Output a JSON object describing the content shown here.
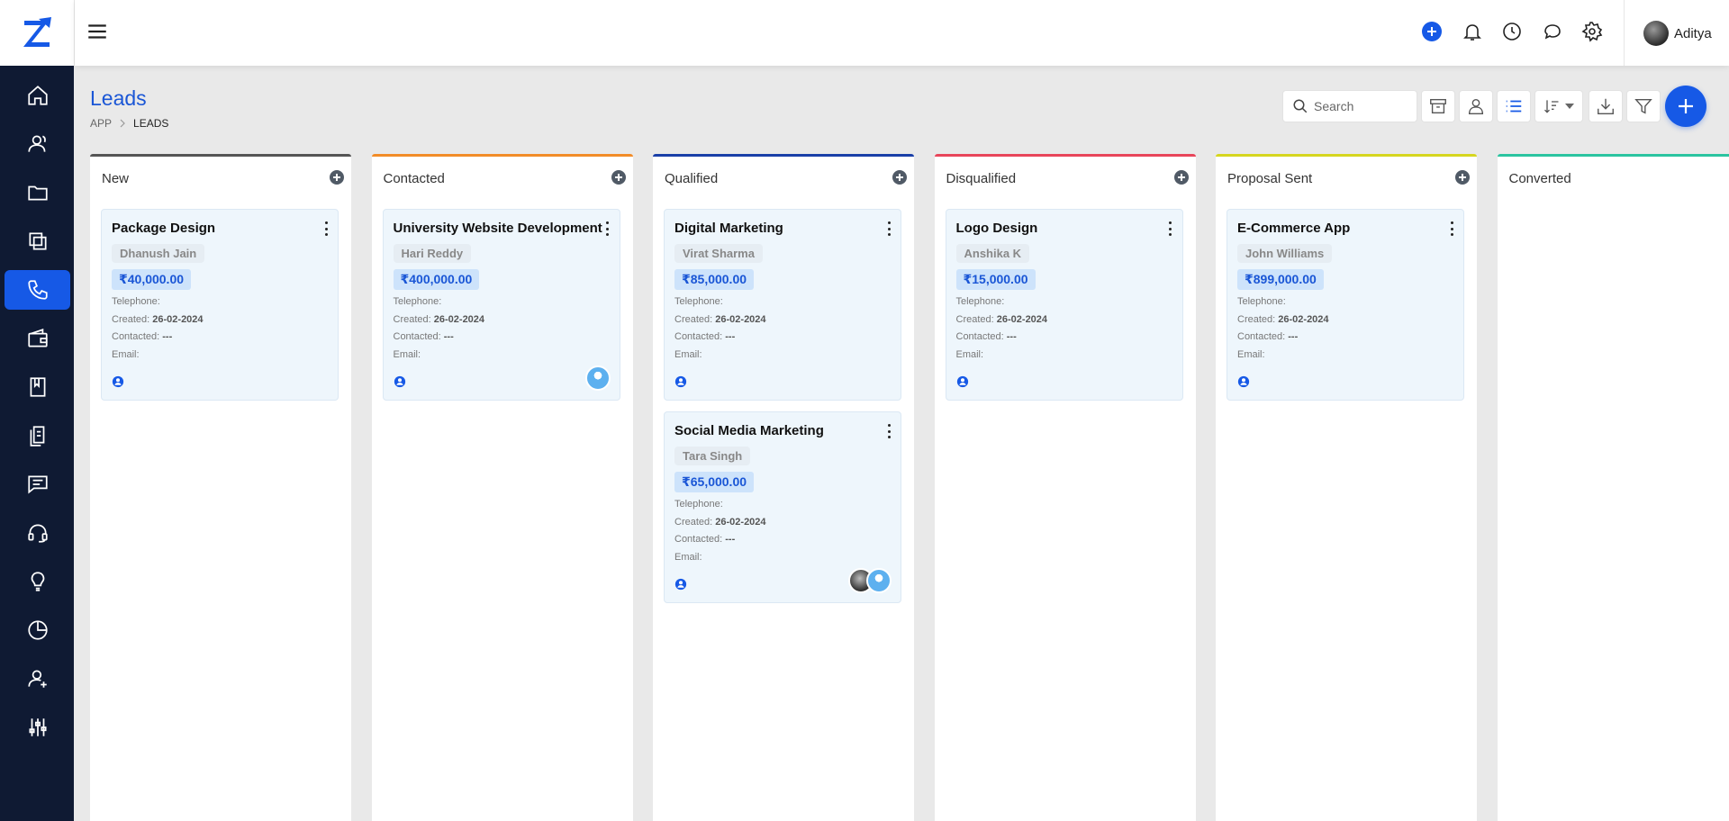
{
  "user": {
    "name": "Aditya"
  },
  "page": {
    "title": "Leads"
  },
  "breadcrumb": {
    "root": "APP",
    "current": "LEADS"
  },
  "toolbar": {
    "search_placeholder": "Search"
  },
  "colors": {
    "accent": "#1659e6",
    "sidebar": "#0f1a33"
  },
  "sidebar_icons": [
    "home-icon",
    "contacts-icon",
    "folder-icon",
    "copy-icon",
    "phone-icon",
    "wallet-icon",
    "book-icon",
    "documents-icon",
    "chat-icon",
    "headset-icon",
    "lightbulb-icon",
    "pie-chart-icon",
    "user-add-icon",
    "sliders-icon"
  ],
  "columns": [
    {
      "name": "New",
      "color": "#555555",
      "cards": [
        {
          "title": "Package Design",
          "contact": "Dhanush Jain",
          "amount": "₹40,000.00",
          "telephone": "",
          "created": "26-02-2024",
          "contacted": "---",
          "email": "",
          "avatars": []
        }
      ]
    },
    {
      "name": "Contacted",
      "color": "#f28c28",
      "cards": [
        {
          "title": "University Website Development",
          "contact": "Hari Reddy",
          "amount": "₹400,000.00",
          "telephone": "",
          "created": "26-02-2024",
          "contacted": "---",
          "email": "",
          "avatars": [
            "blue"
          ]
        }
      ]
    },
    {
      "name": "Qualified",
      "color": "#1a3fa8",
      "cards": [
        {
          "title": "Digital Marketing",
          "contact": "Virat Sharma",
          "amount": "₹85,000.00",
          "telephone": "",
          "created": "26-02-2024",
          "contacted": "---",
          "email": "",
          "avatars": []
        },
        {
          "title": "Social Media Marketing",
          "contact": "Tara Singh",
          "amount": "₹65,000.00",
          "telephone": "",
          "created": "26-02-2024",
          "contacted": "---",
          "email": "",
          "avatars": [
            "photo",
            "blue"
          ]
        }
      ]
    },
    {
      "name": "Disqualified",
      "color": "#e8455a",
      "cards": [
        {
          "title": "Logo Design",
          "contact": "Anshika K",
          "amount": "₹15,000.00",
          "telephone": "",
          "created": "26-02-2024",
          "contacted": "---",
          "email": "",
          "avatars": []
        }
      ]
    },
    {
      "name": "Proposal Sent",
      "color": "#d6d61f",
      "cards": [
        {
          "title": "E-Commerce App",
          "contact": "John Williams",
          "amount": "₹899,000.00",
          "telephone": "",
          "created": "26-02-2024",
          "contacted": "---",
          "email": "",
          "avatars": []
        }
      ]
    },
    {
      "name": "Converted",
      "color": "#2bc4a0",
      "cards": []
    }
  ],
  "labels": {
    "telephone": "Telephone:",
    "created": "Created:",
    "contacted": "Contacted:",
    "email": "Email:"
  }
}
